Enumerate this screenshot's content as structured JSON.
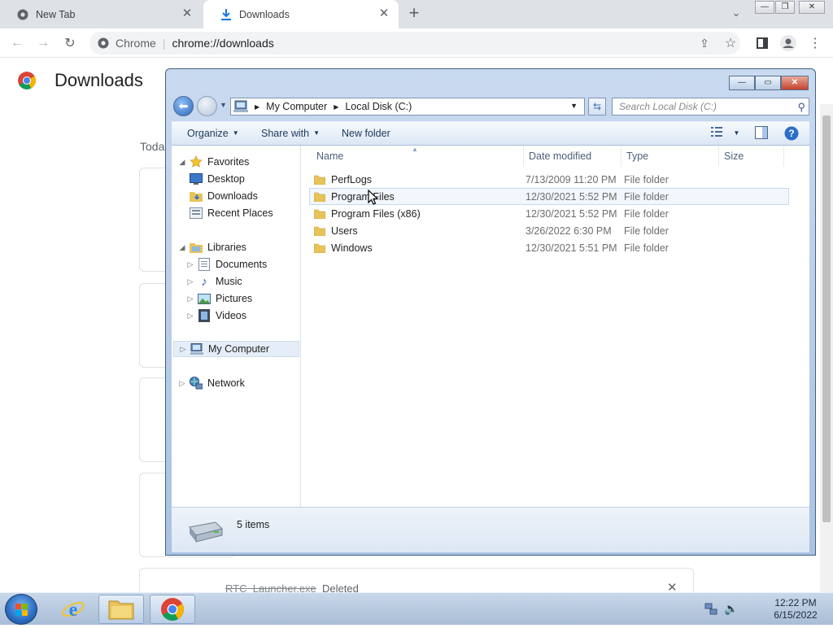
{
  "chrome": {
    "tabs": [
      {
        "title": "New Tab",
        "active": false
      },
      {
        "title": "Downloads",
        "active": true
      }
    ],
    "omnibox": {
      "site": "Chrome",
      "url": "chrome://downloads"
    }
  },
  "downloads_page": {
    "title": "Downloads",
    "section": "Toda",
    "last_item": {
      "filename": "RTC_Launcher.exe",
      "status": "Deleted"
    }
  },
  "explorer": {
    "breadcrumb": [
      "My Computer",
      "Local Disk (C:)"
    ],
    "search_placeholder": "Search Local Disk (C:)",
    "commands": {
      "organize": "Organize",
      "share": "Share with",
      "new_folder": "New folder"
    },
    "nav": {
      "favorites": "Favorites",
      "desktop": "Desktop",
      "downloads": "Downloads",
      "recent": "Recent Places",
      "libraries": "Libraries",
      "documents": "Documents",
      "music": "Music",
      "pictures": "Pictures",
      "videos": "Videos",
      "computer": "My Computer",
      "network": "Network"
    },
    "columns": {
      "name": "Name",
      "date": "Date modified",
      "type": "Type",
      "size": "Size"
    },
    "rows": [
      {
        "name": "PerfLogs",
        "date": "7/13/2009 11:20 PM",
        "type": "File folder"
      },
      {
        "name": "Program Files",
        "date": "12/30/2021 5:52 PM",
        "type": "File folder"
      },
      {
        "name": "Program Files (x86)",
        "date": "12/30/2021 5:52 PM",
        "type": "File folder"
      },
      {
        "name": "Users",
        "date": "3/26/2022 6:30 PM",
        "type": "File folder"
      },
      {
        "name": "Windows",
        "date": "12/30/2021 5:51 PM",
        "type": "File folder"
      }
    ],
    "item_count": "5 items"
  },
  "taskbar": {
    "time": "12:22 PM",
    "date": "6/15/2022"
  },
  "colors": {
    "chrome_tabstrip": "#dee1e6",
    "explorer_frame": "#a9c3e2",
    "taskbar": "#b4c7de",
    "folder": "#e8c35a"
  }
}
